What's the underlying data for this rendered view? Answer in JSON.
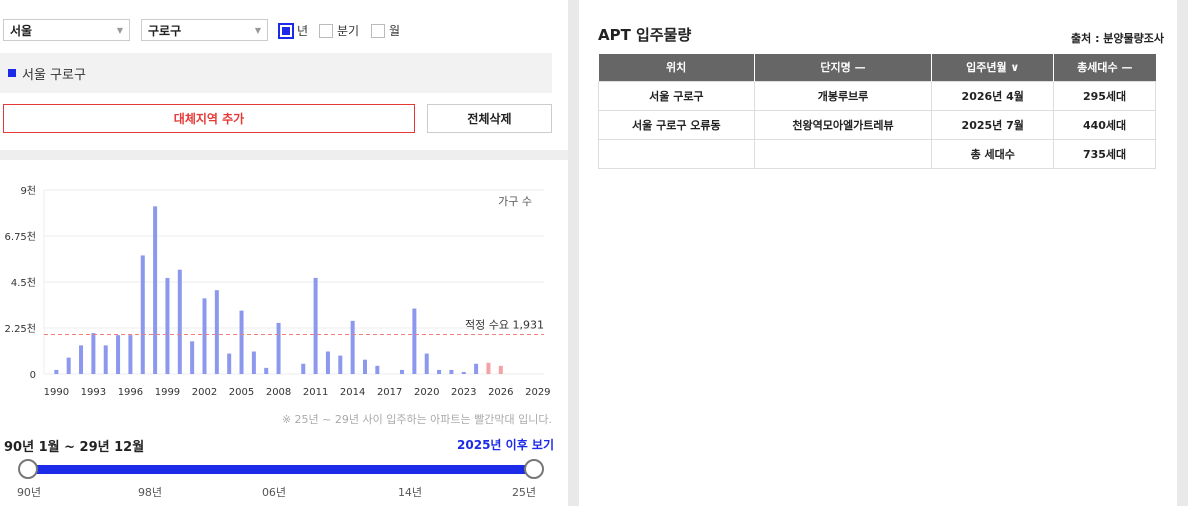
{
  "filters": {
    "city": "서울",
    "district": "구로구",
    "period_options": [
      {
        "label": "년",
        "checked": true
      },
      {
        "label": "분기",
        "checked": false
      },
      {
        "label": "월",
        "checked": false
      }
    ]
  },
  "region_tag": "서울 구로구",
  "buttons": {
    "add_region": "대체지역 추가",
    "delete_all": "전체삭제"
  },
  "chart_data": {
    "type": "bar",
    "legend": "가구 수",
    "y_ticks": [
      "0",
      "2.25천",
      "4.5천",
      "6.75천",
      "9천"
    ],
    "ylim": [
      0,
      9000
    ],
    "x_ticks": [
      "1990",
      "1993",
      "1996",
      "1999",
      "2002",
      "2005",
      "2008",
      "2011",
      "2014",
      "2017",
      "2020",
      "2023",
      "2026",
      "2029"
    ],
    "xlim": [
      1989,
      2029.5
    ],
    "series": [
      {
        "values": [
          [
            1990,
            200
          ],
          [
            1991,
            800
          ],
          [
            1992,
            1400
          ],
          [
            1993,
            2000
          ],
          [
            1994,
            1400
          ],
          [
            1995,
            1900
          ],
          [
            1996,
            1900
          ],
          [
            1997,
            5800
          ],
          [
            1998,
            8200
          ],
          [
            1999,
            4700
          ],
          [
            2000,
            5100
          ],
          [
            2001,
            1600
          ],
          [
            2002,
            3700
          ],
          [
            2003,
            4100
          ],
          [
            2004,
            1000
          ],
          [
            2005,
            3100
          ],
          [
            2006,
            1100
          ],
          [
            2007,
            300
          ],
          [
            2008,
            2500
          ],
          [
            2010,
            500
          ],
          [
            2011,
            4700
          ],
          [
            2012,
            1100
          ],
          [
            2013,
            900
          ],
          [
            2014,
            2600
          ],
          [
            2015,
            700
          ],
          [
            2016,
            400
          ],
          [
            2018,
            200
          ],
          [
            2019,
            3200
          ],
          [
            2020,
            1000
          ],
          [
            2021,
            200
          ],
          [
            2022,
            200
          ],
          [
            2023,
            100
          ],
          [
            2024,
            500
          ]
        ]
      },
      {
        "values": [
          [
            2025,
            550
          ],
          [
            2026,
            400
          ]
        ]
      }
    ],
    "reference_line": {
      "label": "적정 수요 1,931",
      "value": 1931
    },
    "colors": {
      "past": "#8c97ee",
      "future": "#f3a3a3",
      "reference": "#f08080"
    }
  },
  "chart_note": "※ 25년 ~ 29년 사이 입주하는 아파트는 빨간막대 입니다.",
  "period_range": "90년 1월 ~ 29년 12월",
  "future_link": "2025년 이후 보기",
  "slider": {
    "labels": [
      "90년",
      "98년",
      "06년",
      "14년",
      "25년"
    ],
    "range": [
      0,
      1
    ]
  },
  "apt": {
    "title": "APT 입주물량",
    "source": "출처 : 분양물량조사",
    "headers": [
      "위치",
      "단지명 —",
      "입주년월 ∨",
      "총세대수 —"
    ],
    "rows": [
      [
        "서울 구로구",
        "개봉루브루",
        "2026년 4월",
        "295세대"
      ],
      [
        "서울 구로구 오류동",
        "천왕역모아엘가트레뷰",
        "2025년 7월",
        "440세대"
      ],
      [
        "",
        "",
        "총 세대수",
        "735세대"
      ]
    ]
  }
}
